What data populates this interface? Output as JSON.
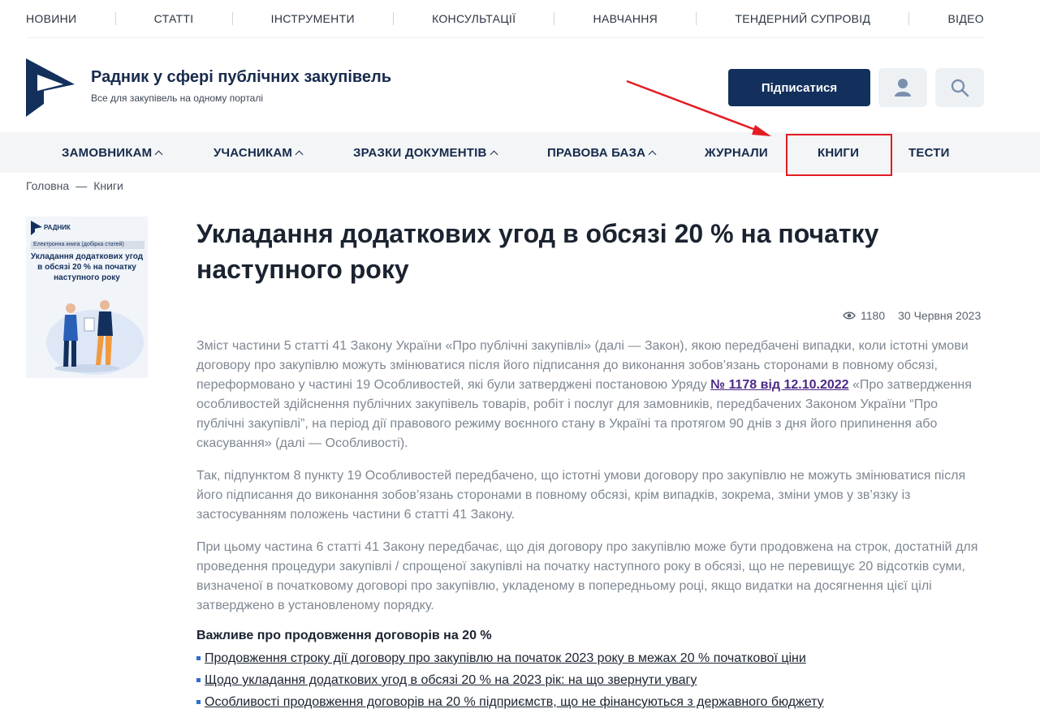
{
  "top_nav": [
    "НОВИНИ",
    "СТАТТІ",
    "ІНСТРУМЕНТИ",
    "КОНСУЛЬТАЦІЇ",
    "НАВЧАННЯ",
    "ТЕНДЕРНИЙ СУПРОВІД",
    "ВІДЕО"
  ],
  "header": {
    "title": "Радник у сфері публічних закупівель",
    "tagline": "Все для закупівель на одному порталі",
    "subscribe_label": "Підписатися",
    "user_icon": "user-icon",
    "search_icon": "search-icon"
  },
  "main_nav": [
    {
      "label": "ЗАМОВНИКАМ",
      "has_dropdown": true
    },
    {
      "label": "УЧАСНИКАМ",
      "has_dropdown": true
    },
    {
      "label": "ЗРАЗКИ ДОКУМЕНТІВ",
      "has_dropdown": true
    },
    {
      "label": "ПРАВОВА БАЗА",
      "has_dropdown": true
    },
    {
      "label": "ЖУРНАЛИ",
      "has_dropdown": false
    },
    {
      "label": "КНИГИ",
      "has_dropdown": false,
      "highlighted": true
    },
    {
      "label": "ТЕСТИ",
      "has_dropdown": false
    }
  ],
  "breadcrumb": {
    "home": "Головна",
    "separator": "—",
    "current": "Книги"
  },
  "cover": {
    "brand": "РАДНИК",
    "banner": "Електронна книга (добірка статей)",
    "title": "Укладання додаткових угод в обсязі 20 % на початку наступного року"
  },
  "article": {
    "title": "Укладання додаткових угод в обсязі 20 % на початку наступного року",
    "views": "1180",
    "date": "30 Червня 2023",
    "p1_before": "Зміст частини 5 статті 41 Закону України «Про публічні закупівлі» (далі — Закон), якою передбачені випадки, коли істотні умови договору про закупівлю можуть змінюватися після його підписання до виконання зобов’язань сторонами в повному обсязі, переформовано у частині 19 Особливостей, які були затверджені постановою Уряду ",
    "p1_link": "№ 1178 від 12.10.2022",
    "p1_after": " «Про затвердження особливостей здійснення публічних закупівель товарів, робіт і послуг для замовників, передбачених Законом України “Про публічні закупівлі”, на період дії правового режиму воєнного стану в Україні та протягом 90 днів з дня його припинення або скасування» (далі — Особливості).",
    "p2": "Так, підпунктом 8 пункту 19 Особливостей передбачено, що істотні умови договору про закупівлю не можуть змінюватися після його підписання до виконання зобов’язань сторонами в повному обсязі, крім випадків, зокрема, зміни умов у зв’язку із застосуванням положень частини 6 статті 41 Закону.",
    "p3": "При цьому частина 6 статті 41 Закону передбачає, що дія договору про закупівлю може бути продовжена на строк, достатній для проведення процедури закупівлі / спрощеної закупівлі на початку наступного року в обсязі, що не перевищує 20 відсотків суми, визначеної в початковому договорі про закупівлю, укладеному в попередньому році, якщо видатки на досягнення цієї цілі затверджено в установленому порядку.",
    "subhead": "Важливе про продовження договорів на 20 %",
    "links": [
      "Продовження строку дії договору про закупівлю на початок 2023 року в межах 20 % початкової ціни",
      "Щодо укладання додаткових угод в обсязі 20 % на 2023 рік: на що звернути увагу",
      "Особливості продовження договорів на 20 % підприємств, що не фінансуються з державного бюджету"
    ]
  },
  "colors": {
    "brand_navy": "#13305d",
    "annotation_red": "#e31b23",
    "link_purple": "#4c2a86",
    "bullet_blue": "#2d6fd0"
  }
}
